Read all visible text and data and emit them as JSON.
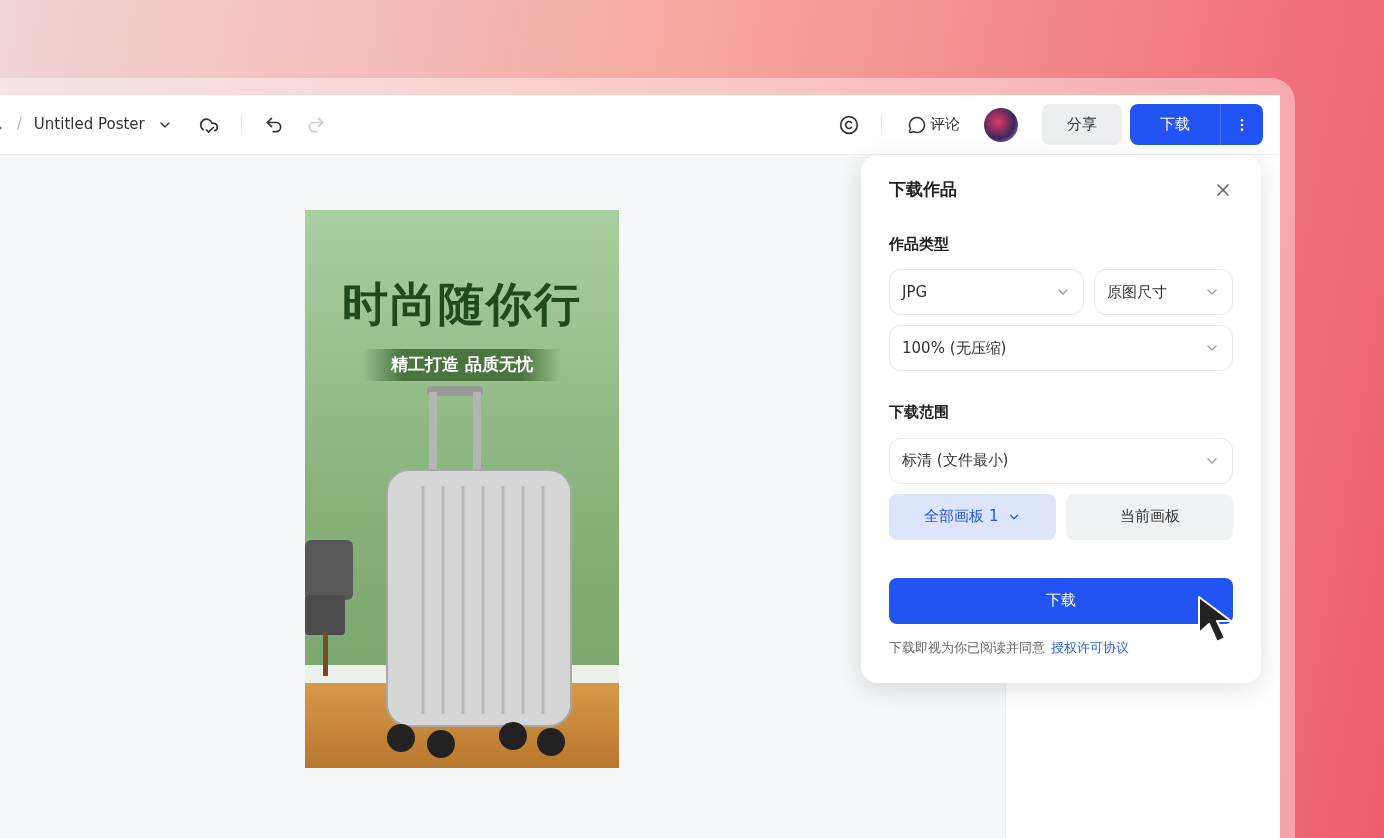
{
  "toolbar": {
    "breadcrumb_fragment": ".",
    "breadcrumb_separator": "/",
    "document_title": "Untitled Poster",
    "comment_label": "评论",
    "share_label": "分享",
    "download_label": "下载"
  },
  "poster": {
    "headline": "时尚随你行",
    "subtitle": "精工打造 品质无忧"
  },
  "download_panel": {
    "title": "下载作品",
    "type_section": {
      "label": "作品类型",
      "format": "JPG",
      "size": "原图尺寸",
      "quality": "100% (无压缩)"
    },
    "range_section": {
      "label": "下载范围",
      "resolution": "标清 (文件最小)",
      "options": [
        {
          "label": "全部画板 1",
          "selected": true,
          "has_menu": true
        },
        {
          "label": "当前画板",
          "selected": false,
          "has_menu": false
        }
      ]
    },
    "download_button": "下载",
    "agreement_text": "下载即视为你已阅读并同意",
    "agreement_link": "授权许可协议"
  }
}
